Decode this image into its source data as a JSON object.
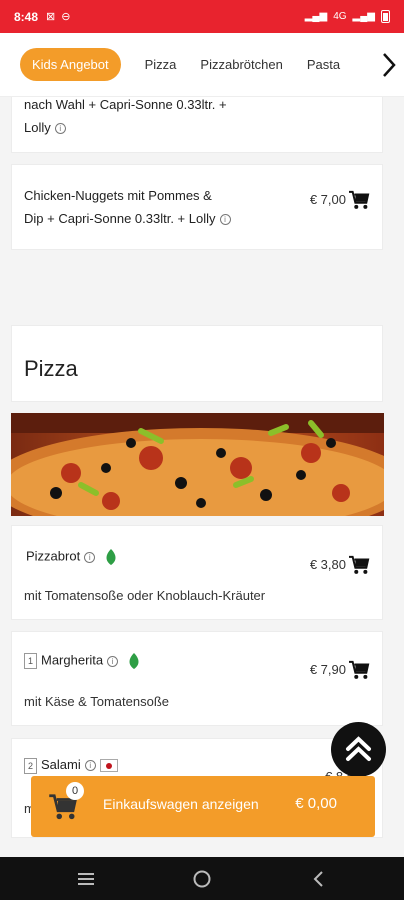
{
  "status": {
    "time": "8:48",
    "indicators": "4G"
  },
  "tabs": [
    {
      "label": "Kids Angebot"
    },
    {
      "label": "Pizza"
    },
    {
      "label": "Pizzabrötchen"
    },
    {
      "label": "Pasta"
    }
  ],
  "kids": {
    "item1_line1": "nach Wahl + Capri-Sonne 0.33ltr. +",
    "item1_line2": "Lolly",
    "item2_line1": "Chicken-Nuggets mit Pommes &",
    "item2_line2": "Dip + Capri-Sonne 0.33ltr. + Lolly",
    "item2_price": "€ 7,00"
  },
  "pizza_section": {
    "title": "Pizza"
  },
  "pizzas": [
    {
      "num": "",
      "name": "Pizzabrot",
      "price": "€ 3,80",
      "desc": "mit Tomatensoße oder Knoblauch-Kräuter"
    },
    {
      "num": "1",
      "name": "Margherita",
      "price": "€ 7,90",
      "desc": "mit Käse & Tomatensoße"
    },
    {
      "num": "2",
      "name": "Salami",
      "price": "€ 8,5",
      "desc": "m"
    }
  ],
  "cart": {
    "count": "0",
    "label": "Einkaufswagen anzeigen",
    "total": "€ 0,00"
  },
  "colors": {
    "status_red": "#e8232e",
    "accent_orange": "#f39c29"
  }
}
